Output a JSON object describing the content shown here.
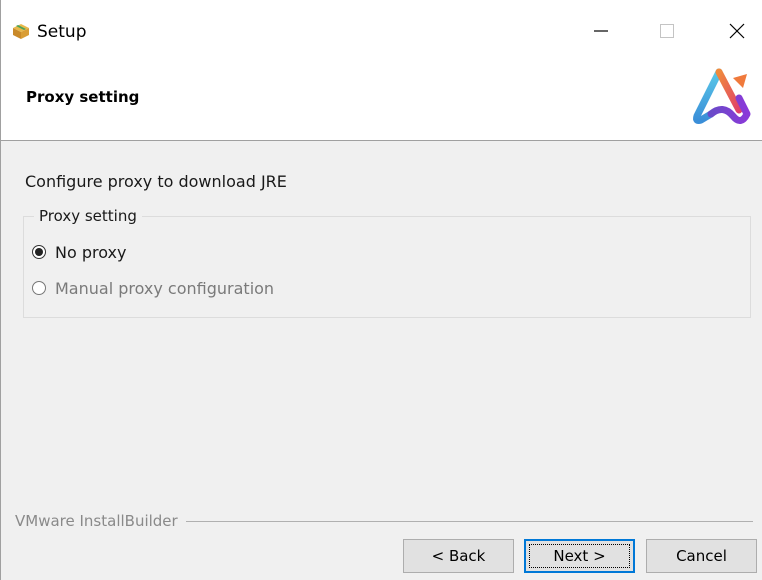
{
  "window": {
    "title": "Setup",
    "icons": {
      "app": "package-icon",
      "minimize": "minimize-icon",
      "maximize": "maximize-icon",
      "close": "close-icon"
    }
  },
  "header": {
    "title": "Proxy setting",
    "logo": "brand-logo-icon"
  },
  "content": {
    "intro": "Configure proxy to download JRE",
    "group": {
      "legend": "Proxy setting",
      "options": [
        {
          "label": "No proxy",
          "selected": true,
          "enabled": true
        },
        {
          "label": "Manual proxy configuration",
          "selected": false,
          "enabled": false
        }
      ]
    }
  },
  "footer": {
    "brand": "VMware InstallBuilder",
    "buttons": {
      "back": "< Back",
      "next": "Next >",
      "cancel": "Cancel"
    }
  },
  "colors": {
    "background": "#f0f0f0",
    "focus_border": "#0078d7",
    "disabled_text": "#7a7a7a"
  }
}
